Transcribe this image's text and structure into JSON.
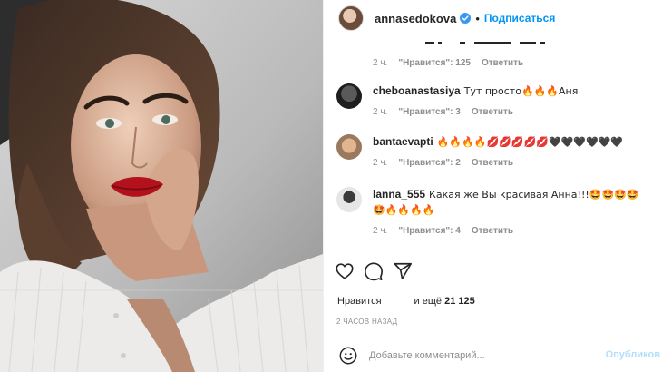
{
  "post": {
    "username": "annasedokova",
    "verified_icon": "verified-badge-icon",
    "separator": "•",
    "follow_label": "Подписаться",
    "photo_icon": "portrait-photo"
  },
  "comments": [
    {
      "username": "",
      "text": "",
      "time": "2 ч.",
      "likes": "\"Нравится\": 125",
      "reply": "Ответить"
    },
    {
      "username": "cheboanastasiya",
      "text": "Тут просто🔥🔥🔥Аня",
      "time": "2 ч.",
      "likes": "\"Нравится\": 3",
      "reply": "Ответить"
    },
    {
      "username": "bantaevapti",
      "text": "🔥🔥🔥🔥💋💋💋💋💋🖤🖤🖤🖤🖤🖤",
      "time": "2 ч.",
      "likes": "\"Нравится\": 2",
      "reply": "Ответить"
    },
    {
      "username": "lanna_555",
      "text": "Какая же Вы красивая Анна!!!🤩🤩🤩🤩🤩🔥🔥🔥🔥",
      "time": "2 ч.",
      "likes": "\"Нравится\": 4",
      "reply": "Ответить"
    }
  ],
  "actions": {
    "like_icon": "heart-icon",
    "comment_icon": "comment-icon",
    "share_icon": "share-icon"
  },
  "likes": {
    "label": "Нравится",
    "and": "и ещё",
    "count": "21 125"
  },
  "time_ago": "2 ЧАСОВ НАЗАД",
  "add_comment": {
    "emoji_icon": "smiley-icon",
    "placeholder": "Добавьте комментарий...",
    "post_label": "Опубликов"
  },
  "colors": {
    "accent": "#0095f6",
    "muted": "#8e8e8e",
    "text": "#262626",
    "post_disabled": "#b2dffc"
  }
}
